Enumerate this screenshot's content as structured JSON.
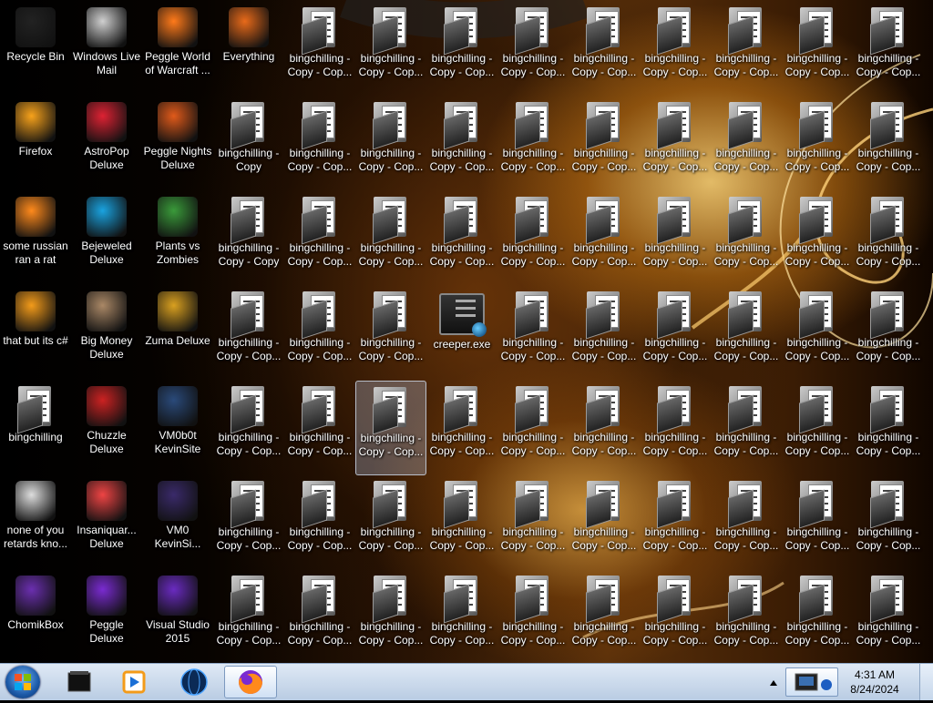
{
  "desktop": {
    "columns": [
      [
        "Recycle Bin",
        "Firefox",
        "some russian\nran a rat",
        "that but its c#",
        "bingchilling",
        "none of you\nretards kno...",
        "ChomikBox"
      ],
      [
        "Windows Live\nMail",
        "AstroPop\nDeluxe",
        "Bejeweled\nDeluxe",
        "Big Money\nDeluxe",
        "Chuzzle\nDeluxe",
        "Insaniquar...\nDeluxe",
        "Peggle Deluxe"
      ],
      [
        "Peggle World\nof Warcraft ...",
        "Peggle Nights\nDeluxe",
        "Plants vs\nZombies",
        "Zuma Deluxe",
        "VM0b0t\nKevinSite",
        "VM0\nKevinSi...",
        "Visual Studio\n2015"
      ],
      [
        "Everything",
        "bingchilling -\nCopy",
        "bingchilling -\nCopy - Copy",
        "bingchilling -\nCopy - Cop...",
        "bingchilling -\nCopy - Cop...",
        "bingchilling -\nCopy - Cop...",
        "bingchilling -\nCopy - Cop..."
      ]
    ],
    "folder_label": "bingchilling -\nCopy - Cop...",
    "exe_label": "creeper.exe",
    "exe_cell": [
      6,
      3
    ],
    "selected_cell": [
      5,
      4
    ]
  },
  "taskbar": {
    "start_label": "Start",
    "pinned": [
      "explorer-icon",
      "media-player-icon",
      "globe-icon",
      "firefox-icon"
    ],
    "clock_time": "4:31 AM",
    "clock_date": "8/24/2024"
  },
  "colors": {
    "taskbar": "#c8d8ec",
    "label_text": "#ffffff",
    "selection": "#c8dcff"
  }
}
